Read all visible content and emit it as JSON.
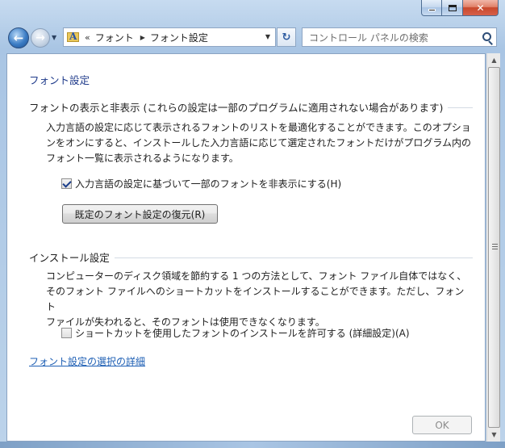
{
  "window": {
    "caption_buttons": {
      "minimize_icon": "minimize-icon",
      "maximize_icon": "maximize-icon",
      "close_icon": "close-icon",
      "close_label": "✕"
    }
  },
  "nav": {
    "back_glyph": "←",
    "forward_glyph": "→",
    "history_glyph": "▼",
    "address": {
      "chevron": "«",
      "crumbs": [
        "フォント",
        "フォント設定"
      ],
      "separator": "▶",
      "dropdown_glyph": "▼"
    },
    "refresh_glyph": "↻",
    "search_placeholder": "コントロール パネルの検索"
  },
  "content": {
    "page_title": "フォント設定",
    "show_hide": {
      "heading": "フォントの表示と非表示 (これらの設定は一部のプログラムに適用されない場合があります)",
      "lines": [
        "入力言語の設定に応じて表示されるフォントのリストを最適化することができます。このオプショ",
        "ンをオンにすると、インストールした入力言語に応じて選定されたフォントだけがプログラム内の",
        "フォント一覧に表示されるようになります。"
      ],
      "checkbox_label": "入力言語の設定に基づいて一部のフォントを非表示にする(H)",
      "checkbox_checked": true,
      "restore_button": "既定のフォント設定の復元(R)"
    },
    "install": {
      "heading": "インストール設定",
      "lines": [
        "コンピューターのディスク領域を節約する 1 つの方法として、フォント ファイル自体ではなく、",
        "そのフォント ファイルへのショートカットをインストールすることができます。ただし、フォント",
        "ファイルが失われると、そのフォントは使用できなくなります。"
      ],
      "checkbox_label": "ショートカットを使用したフォントのインストールを許可する (詳細設定)(A)",
      "checkbox_checked": false
    },
    "help_link": "フォント設定の選択の詳細",
    "ok_button": "OK"
  },
  "scrollbar": {
    "up_glyph": "▲",
    "down_glyph": "▼"
  }
}
